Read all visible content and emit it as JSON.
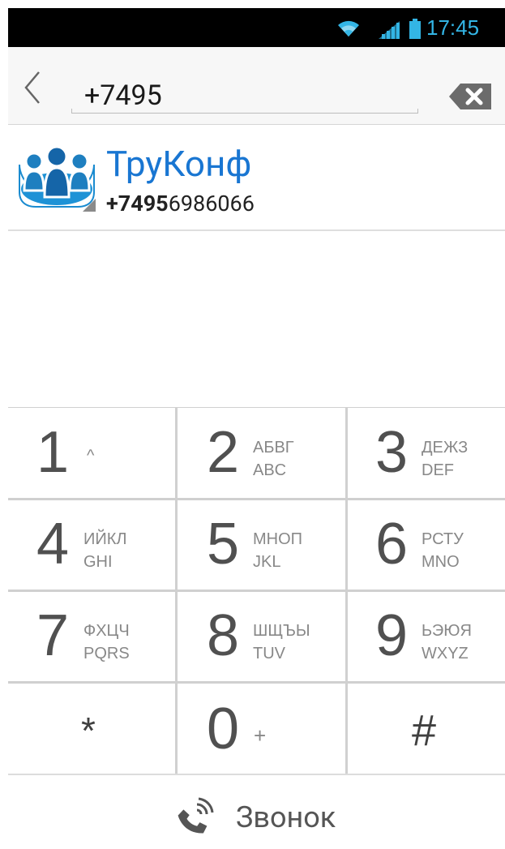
{
  "status_bar": {
    "time": "17:45",
    "accent_color": "#33b5e5"
  },
  "input_bar": {
    "number_value": "+7495"
  },
  "suggestion": {
    "name": "ТруКонф",
    "number_bold": "+7495",
    "number_rest": "6986066",
    "name_color": "#1976d2"
  },
  "keypad": {
    "keys": [
      {
        "digit": "1",
        "l1": "^",
        "l2": ""
      },
      {
        "digit": "2",
        "l1": "АБВГ",
        "l2": "ABC"
      },
      {
        "digit": "3",
        "l1": "ДЕЖЗ",
        "l2": "DEF"
      },
      {
        "digit": "4",
        "l1": "ИЙКЛ",
        "l2": "GHI"
      },
      {
        "digit": "5",
        "l1": "МНОП",
        "l2": "JKL"
      },
      {
        "digit": "6",
        "l1": "РСТУ",
        "l2": "MNO"
      },
      {
        "digit": "7",
        "l1": "ФХЦЧ",
        "l2": "PQRS"
      },
      {
        "digit": "8",
        "l1": "ШЩЪЫ",
        "l2": "TUV"
      },
      {
        "digit": "9",
        "l1": "ЬЭЮЯ",
        "l2": "WXYZ"
      },
      {
        "symbol": "*"
      },
      {
        "digit": "0",
        "l1": "+",
        "l2": ""
      },
      {
        "symbol": "#"
      }
    ]
  },
  "call_bar": {
    "label": "Звонок"
  }
}
